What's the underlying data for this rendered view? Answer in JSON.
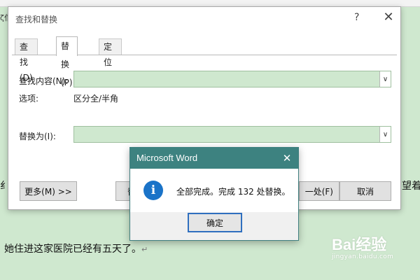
{
  "document": {
    "left_fragment": "纟",
    "right_fragment": "望着",
    "top_fragment": "ζ佄",
    "bottom_line": "她住进这家医院已经有五天了。",
    "paragraph_mark": "↵"
  },
  "find_replace": {
    "title": "查找和替换",
    "help": "?",
    "close": "✕",
    "tabs": [
      {
        "label": "查找(D)"
      },
      {
        "label": "替换(P)"
      },
      {
        "label": "定位(G)"
      }
    ],
    "find_label": "查找内容(N):",
    "options_label": "选项:",
    "options_value": "区分全/半角",
    "replace_label": "替换为(I):",
    "dropdown_arrow": "∨",
    "more_button": "更多(M) >>",
    "replace_button_fragment": "替",
    "find_next_fragment": "一处(F)",
    "cancel_button": "取消"
  },
  "message_box": {
    "title": "Microsoft Word",
    "close": "✕",
    "icon_glyph": "i",
    "message": "全部完成。完成 132 处替换。",
    "ok_button": "确定"
  },
  "watermark": {
    "main": "Bai经验",
    "sub": "jingyan.baidu.com"
  },
  "colors": {
    "document_bg": "#cfe8cf",
    "message_title_bg": "#3d8280",
    "info_icon": "#1a73c8",
    "ok_focus_border": "#2f6fbf"
  }
}
